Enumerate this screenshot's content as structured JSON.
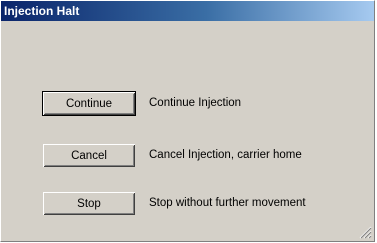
{
  "window": {
    "title": "Injection Halt"
  },
  "actions": [
    {
      "button_label": "Continue",
      "description": "Continue Injection",
      "is_default": true
    },
    {
      "button_label": "Cancel",
      "description": "Cancel Injection, carrier home",
      "is_default": false
    },
    {
      "button_label": "Stop",
      "description": "Stop without further movement",
      "is_default": false
    }
  ],
  "colors": {
    "face": "#d4d0c8",
    "title_start": "#0a246a",
    "title_end": "#a6caf0",
    "title_text": "#ffffff"
  },
  "icons": {
    "resize_grip": "size-grip-icon"
  }
}
